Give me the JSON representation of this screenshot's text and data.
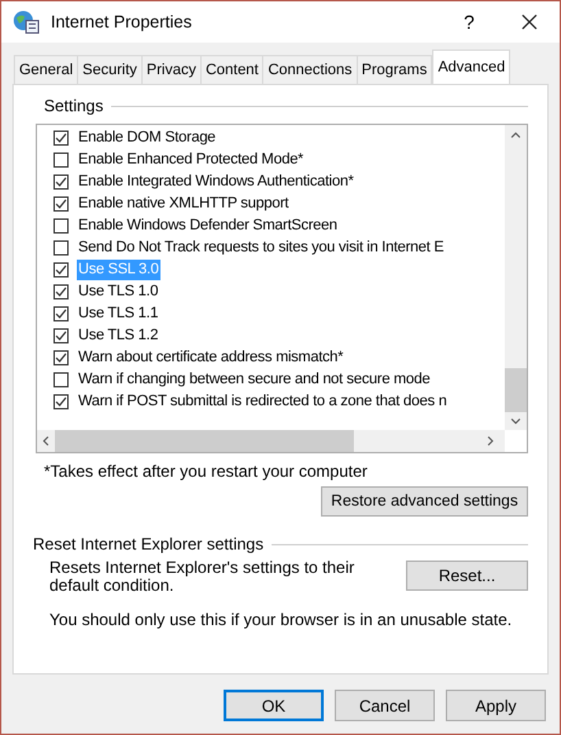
{
  "window": {
    "title": "Internet Properties",
    "help": "?"
  },
  "tabs": [
    {
      "label": "General",
      "selected": false
    },
    {
      "label": "Security",
      "selected": false
    },
    {
      "label": "Privacy",
      "selected": false
    },
    {
      "label": "Content",
      "selected": false
    },
    {
      "label": "Connections",
      "selected": false
    },
    {
      "label": "Programs",
      "selected": false
    },
    {
      "label": "Advanced",
      "selected": true
    }
  ],
  "settings": {
    "title": "Settings",
    "items": [
      {
        "label": "Enable DOM Storage",
        "checked": true,
        "selected": false
      },
      {
        "label": "Enable Enhanced Protected Mode*",
        "checked": false,
        "selected": false
      },
      {
        "label": "Enable Integrated Windows Authentication*",
        "checked": true,
        "selected": false
      },
      {
        "label": "Enable native XMLHTTP support",
        "checked": true,
        "selected": false
      },
      {
        "label": "Enable Windows Defender SmartScreen",
        "checked": false,
        "selected": false
      },
      {
        "label": "Send Do Not Track requests to sites you visit in Internet E",
        "checked": false,
        "selected": false
      },
      {
        "label": "Use SSL 3.0",
        "checked": true,
        "selected": true
      },
      {
        "label": "Use TLS 1.0",
        "checked": true,
        "selected": false
      },
      {
        "label": "Use TLS 1.1",
        "checked": true,
        "selected": false
      },
      {
        "label": "Use TLS 1.2",
        "checked": true,
        "selected": false
      },
      {
        "label": "Warn about certificate address mismatch*",
        "checked": true,
        "selected": false
      },
      {
        "label": "Warn if changing between secure and not secure mode",
        "checked": false,
        "selected": false
      },
      {
        "label": "Warn if POST submittal is redirected to a zone that does n",
        "checked": true,
        "selected": false
      }
    ],
    "footnote": "*Takes effect after you restart your computer",
    "restore_button": "Restore advanced settings"
  },
  "reset": {
    "title": "Reset Internet Explorer settings",
    "description": "Resets Internet Explorer's settings to their default condition.",
    "button": "Reset...",
    "note": "You should only use this if your browser is in an unusable state."
  },
  "buttons": [
    {
      "label": "OK",
      "default": true
    },
    {
      "label": "Cancel",
      "default": false
    },
    {
      "label": "Apply",
      "default": false
    }
  ]
}
